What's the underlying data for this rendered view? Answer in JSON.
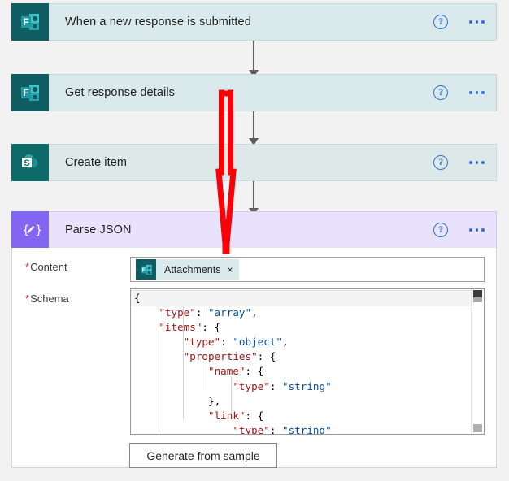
{
  "flow": {
    "steps": [
      {
        "title": "When a new response is submitted",
        "connector": "microsoft-forms",
        "icon_name": "microsoft-forms-icon",
        "theme": "teal",
        "help_label": "?",
        "menu_label": "…"
      },
      {
        "title": "Get response details",
        "connector": "microsoft-forms",
        "icon_name": "microsoft-forms-icon",
        "theme": "teal",
        "help_label": "?",
        "menu_label": "…"
      },
      {
        "title": "Create item",
        "connector": "sharepoint",
        "icon_name": "sharepoint-icon",
        "theme": "teal2",
        "help_label": "?",
        "menu_label": "…"
      },
      {
        "title": "Parse JSON",
        "connector": "data-operation",
        "icon_name": "data-operation-icon",
        "theme": "purple",
        "help_label": "?",
        "menu_label": "…"
      }
    ]
  },
  "parse_json": {
    "content": {
      "label": "Content",
      "required_marker": "*",
      "token": {
        "label": "Attachments",
        "close_label": "×",
        "icon_name": "microsoft-forms-icon",
        "chip_bg": "#d9e9ec"
      }
    },
    "schema": {
      "label": "Schema",
      "required_marker": "*",
      "lines": [
        [
          {
            "t": "{",
            "c": "pun"
          }
        ],
        [
          {
            "t": "    ",
            "c": "pun"
          },
          {
            "t": "\"type\"",
            "c": "key"
          },
          {
            "t": ": ",
            "c": "pun"
          },
          {
            "t": "\"array\"",
            "c": "val"
          },
          {
            "t": ",",
            "c": "pun"
          }
        ],
        [
          {
            "t": "    ",
            "c": "pun"
          },
          {
            "t": "\"items\"",
            "c": "key"
          },
          {
            "t": ": {",
            "c": "pun"
          }
        ],
        [
          {
            "t": "        ",
            "c": "pun"
          },
          {
            "t": "\"type\"",
            "c": "key"
          },
          {
            "t": ": ",
            "c": "pun"
          },
          {
            "t": "\"object\"",
            "c": "val"
          },
          {
            "t": ",",
            "c": "pun"
          }
        ],
        [
          {
            "t": "        ",
            "c": "pun"
          },
          {
            "t": "\"properties\"",
            "c": "key"
          },
          {
            "t": ": {",
            "c": "pun"
          }
        ],
        [
          {
            "t": "            ",
            "c": "pun"
          },
          {
            "t": "\"name\"",
            "c": "key"
          },
          {
            "t": ": {",
            "c": "pun"
          }
        ],
        [
          {
            "t": "                ",
            "c": "pun"
          },
          {
            "t": "\"type\"",
            "c": "key"
          },
          {
            "t": ": ",
            "c": "pun"
          },
          {
            "t": "\"string\"",
            "c": "val"
          }
        ],
        [
          {
            "t": "            },",
            "c": "pun"
          }
        ],
        [
          {
            "t": "            ",
            "c": "pun"
          },
          {
            "t": "\"link\"",
            "c": "key"
          },
          {
            "t": ": {",
            "c": "pun"
          }
        ],
        [
          {
            "t": "                ",
            "c": "pun"
          },
          {
            "t": "\"type\"",
            "c": "key"
          },
          {
            "t": ": ",
            "c": "pun"
          },
          {
            "t": "\"string\"",
            "c": "val"
          }
        ]
      ],
      "active_line": 0
    },
    "generate_button_label": "Generate from sample"
  },
  "annotation": {
    "type": "hand-drawn-arrow",
    "color": "#fb0007",
    "direction": "down"
  },
  "colors": {
    "teal_card": "#d9e9ec",
    "teal2_card": "#dce9e8",
    "purple_card": "#e9e2fc",
    "forms_brand": "#105c63",
    "sharepoint_brand": "#0d6a68",
    "dataop_brand": "#8265f0",
    "help_blue": "#2d6fd6",
    "required_red": "#d13438",
    "json_key": "#a31515",
    "json_value": "#0451a5"
  }
}
